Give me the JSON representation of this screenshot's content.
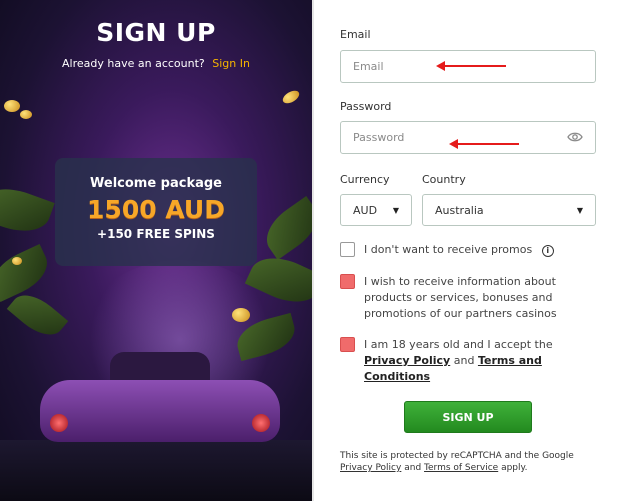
{
  "promo": {
    "title": "SIGN UP",
    "have_account_text": "Already have an account?",
    "sign_in_link": "Sign In",
    "welcome_title": "Welcome package",
    "welcome_amount": "1500 AUD",
    "welcome_spins": "+150 FREE SPINS"
  },
  "form": {
    "email_label": "Email",
    "email_placeholder": "Email",
    "password_label": "Password",
    "password_placeholder": "Password",
    "currency_label": "Currency",
    "currency_value": "AUD",
    "country_label": "Country",
    "country_value": "Australia",
    "promo_opt_out": "I don't want to receive promos",
    "info_icon_glyph": "i",
    "marketing_opt_in": "I wish to receive information about products or services, bonuses and promotions of our partners casinos",
    "age_prefix": "I am 18 years old and I accept the",
    "privacy_policy": "Privacy Policy",
    "and_text": "and",
    "terms": "Terms and Conditions",
    "submit_label": "SIGN UP",
    "recaptcha_prefix": "This site is protected by reCAPTCHA and the Google",
    "recaptcha_privacy": "Privacy Policy",
    "recaptcha_terms": "Terms of Service",
    "recaptcha_suffix": "apply."
  },
  "colors": {
    "accent": "#f5b400",
    "amount": "#f7a728",
    "button": "#2e9e2a",
    "error_checkbox": "#f06b6b",
    "annotation_arrow": "#e51b1b"
  },
  "icons": [
    "eye-icon",
    "info-icon",
    "caret-down-icon",
    "arrow-annotation"
  ]
}
